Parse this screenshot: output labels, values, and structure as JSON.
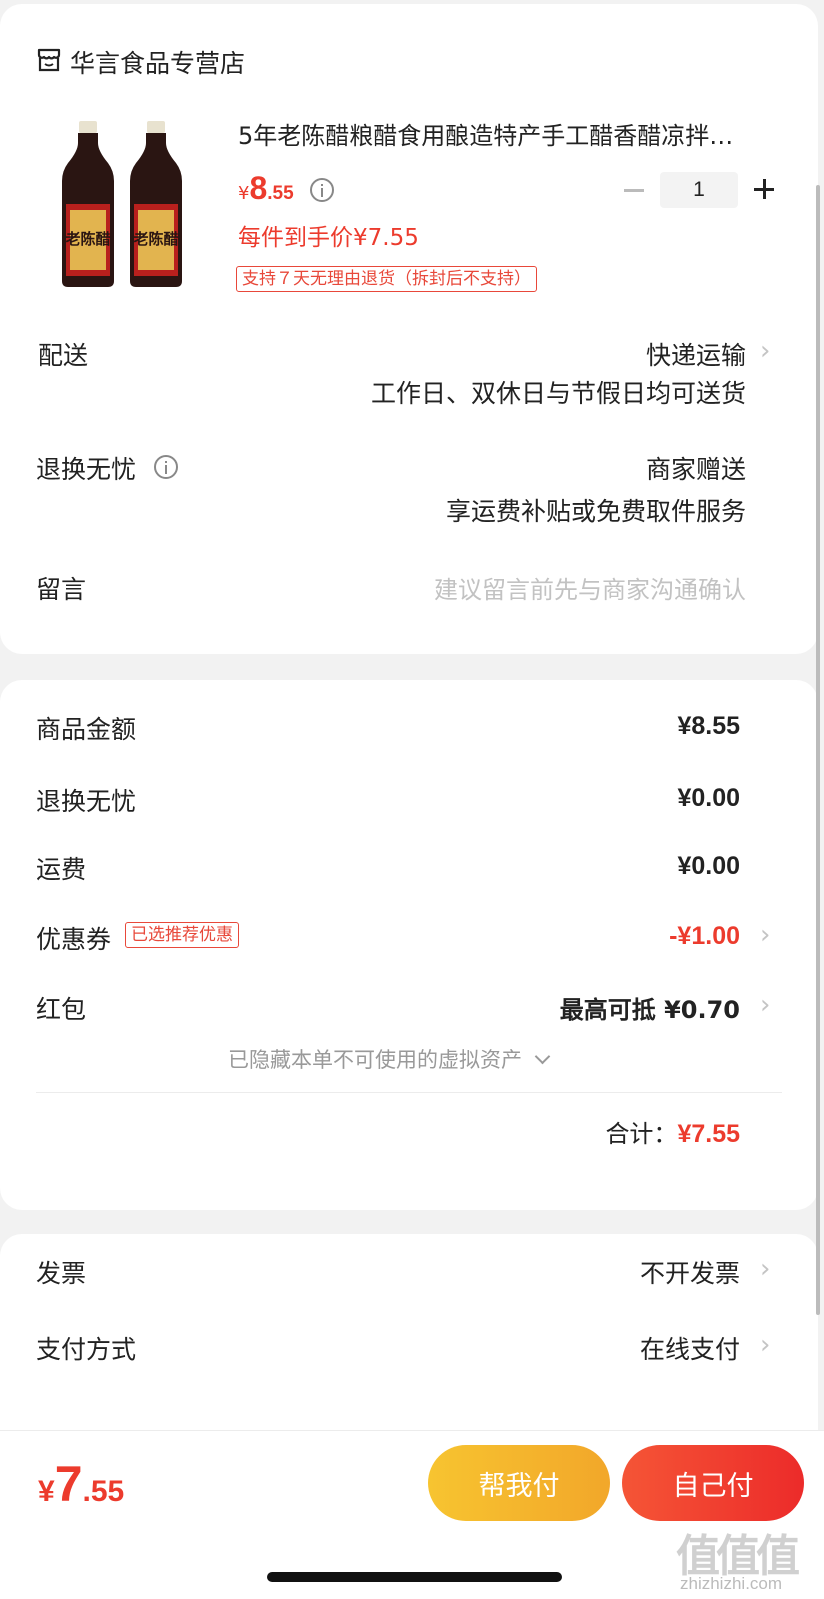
{
  "store": {
    "name": "华言食品专营店",
    "icon": "store-icon"
  },
  "product": {
    "title": "5年老陈醋粮醋食用酿造特产手工醋香醋凉拌…",
    "price_symbol": "¥",
    "price_int": "8",
    "price_dec": ".55",
    "final_price": "每件到手价¥7.55",
    "return_tag": "支持７天无理由退货（拆封后不支持）",
    "quantity": "1",
    "label_text": "老陈醋"
  },
  "delivery": {
    "label": "配送",
    "method": "快递运输",
    "note": "工作日、双休日与节假日均可送货"
  },
  "returns": {
    "label": "退换无忧",
    "value": "商家赠送",
    "note": "享运费补贴或免费取件服务"
  },
  "message": {
    "label": "留言",
    "placeholder": "建议留言前先与商家沟通确认"
  },
  "summary": {
    "goods_label": "商品金额",
    "goods_value": "¥8.55",
    "returns_label": "退换无忧",
    "returns_value": "¥0.00",
    "shipping_label": "运费",
    "shipping_value": "¥0.00",
    "coupon_label": "优惠券",
    "coupon_tag": "已选推荐优惠",
    "coupon_value": "-¥1.00",
    "redpacket_label": "红包",
    "redpacket_value": "最高可抵 ¥0.70",
    "hidden_assets": "已隐藏本单不可使用的虚拟资产",
    "total_label": "合计：",
    "total_value": "¥7.55"
  },
  "invoice": {
    "label": "发票",
    "value": "不开发票"
  },
  "payment": {
    "label": "支付方式",
    "value": "在线支付"
  },
  "footer": {
    "price_symbol": "¥",
    "price_int": "7",
    "price_dec": ".55",
    "help_pay": "帮我付",
    "self_pay": "自己付"
  },
  "watermark": {
    "text": "zhizhizhi.com",
    "logo": "值值值"
  },
  "colors": {
    "accent_red": "#ec3b2d",
    "help_pay_bg": "#f5b52a",
    "self_pay_bg": "#f03a2e"
  }
}
